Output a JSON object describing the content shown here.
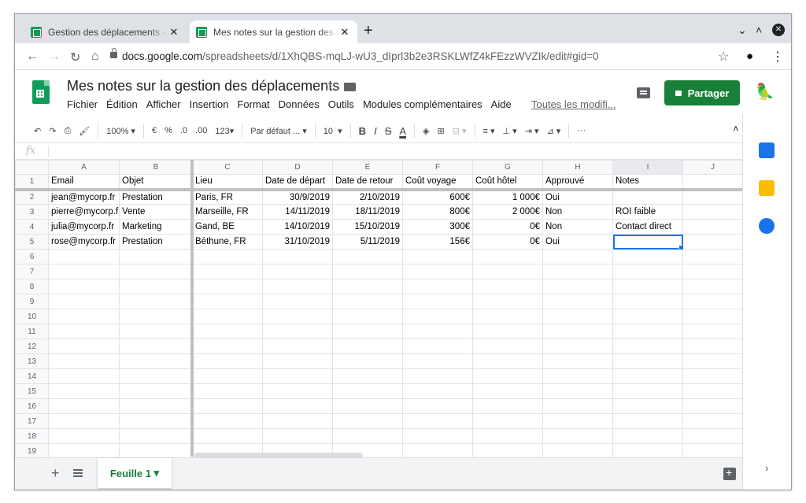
{
  "browser": {
    "tabs": [
      {
        "title": "Gestion des déplacements - C"
      },
      {
        "title": "Mes notes sur la gestion des d"
      }
    ],
    "url_domain": "docs.google.com",
    "url_path": "/spreadsheets/d/1XhQBS-mqLJ-wU3_dIprl3b2e3RSKLWfZ4kFEzzWVZIk/edit#gid=0"
  },
  "doc": {
    "title": "Mes notes sur la gestion des déplacements",
    "menu": [
      "Fichier",
      "Édition",
      "Afficher",
      "Insertion",
      "Format",
      "Données",
      "Outils",
      "Modules complémentaires",
      "Aide"
    ],
    "last_edit": "Toutes les modifi...",
    "share_label": "Partager"
  },
  "toolbar": {
    "zoom": "100%",
    "currency": "€",
    "percent": "%",
    "dec_less": ".0",
    "dec_more": ".00",
    "format_more": "123",
    "font": "Par défaut ...",
    "font_size": "10",
    "bold": "B",
    "italic": "I",
    "strike": "S",
    "text_color": "A",
    "more": "···"
  },
  "formula_bar": {
    "label": "fx",
    "value": ""
  },
  "grid": {
    "columns": [
      "A",
      "B",
      "C",
      "D",
      "E",
      "F",
      "G",
      "H",
      "I",
      "J"
    ],
    "row_numbers": [
      "1",
      "2",
      "3",
      "4",
      "5",
      "6",
      "7",
      "8",
      "9",
      "10",
      "11",
      "12",
      "13",
      "14",
      "15",
      "16",
      "17",
      "18",
      "19"
    ],
    "header": [
      "Email",
      "Objet",
      "Lieu",
      "Date de départ",
      "Date de retour",
      "Coût voyage",
      "Coût hôtel",
      "Approuvé",
      "Notes",
      ""
    ],
    "rows": [
      [
        "jean@mycorp.fr",
        "Prestation",
        "Paris, FR",
        "30/9/2019",
        "2/10/2019",
        "600€",
        "1 000€",
        "Oui",
        "",
        ""
      ],
      [
        "pierre@mycorp.f",
        "Vente",
        "Marseille, FR",
        "14/11/2019",
        "18/11/2019",
        "800€",
        "2 000€",
        "Non",
        "ROI faible",
        ""
      ],
      [
        "julia@mycorp.fr",
        "Marketing",
        "Gand, BE",
        "14/10/2019",
        "15/10/2019",
        "300€",
        "0€",
        "Non",
        "Contact direct",
        ""
      ],
      [
        "rose@mycorp.fr",
        "Prestation",
        "Béthune, FR",
        "31/10/2019",
        "5/11/2019",
        "156€",
        "0€",
        "Oui",
        "",
        ""
      ]
    ],
    "selected_cell": "I5"
  },
  "sheets": [
    {
      "name": "Feuille 1"
    }
  ],
  "colors": {
    "accent_green": "#188038",
    "selection_blue": "#1a73e8",
    "sheets_green": "#0f9d58"
  }
}
